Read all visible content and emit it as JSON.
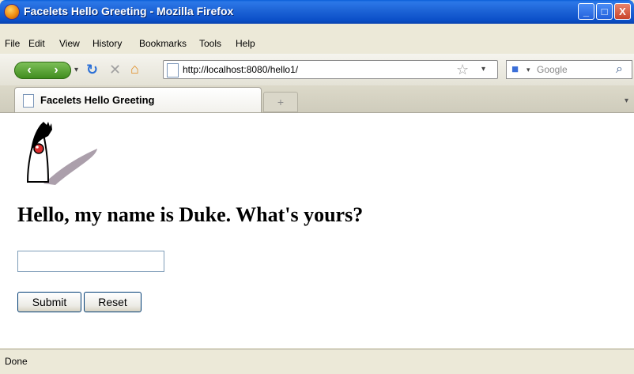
{
  "window": {
    "title": "Facelets Hello Greeting - Mozilla Firefox",
    "controls": {
      "minimize": "_",
      "maximize": "□",
      "close": "X"
    }
  },
  "menubar": {
    "items": [
      "File",
      "Edit",
      "View",
      "History",
      "Bookmarks",
      "Tools",
      "Help"
    ]
  },
  "navbar": {
    "back_icon": "back-arrow-icon",
    "forward_icon": "forward-arrow-icon",
    "url": "http://localhost:8080/hello1/",
    "search_placeholder": "Google"
  },
  "tabs": [
    {
      "label": "Facelets Hello Greeting",
      "active": true
    }
  ],
  "newtab_label": "+",
  "page": {
    "greeting": "Hello, my name is Duke. What's yours?",
    "name_input_value": "",
    "submit_label": "Submit",
    "reset_label": "Reset"
  },
  "status": {
    "text": "Done"
  },
  "colors": {
    "titlebar": "#0b4fc8",
    "nav_green": "#3d8a1c",
    "reload_blue": "#2a6fd6",
    "stop_gray": "#a0a0a0"
  }
}
